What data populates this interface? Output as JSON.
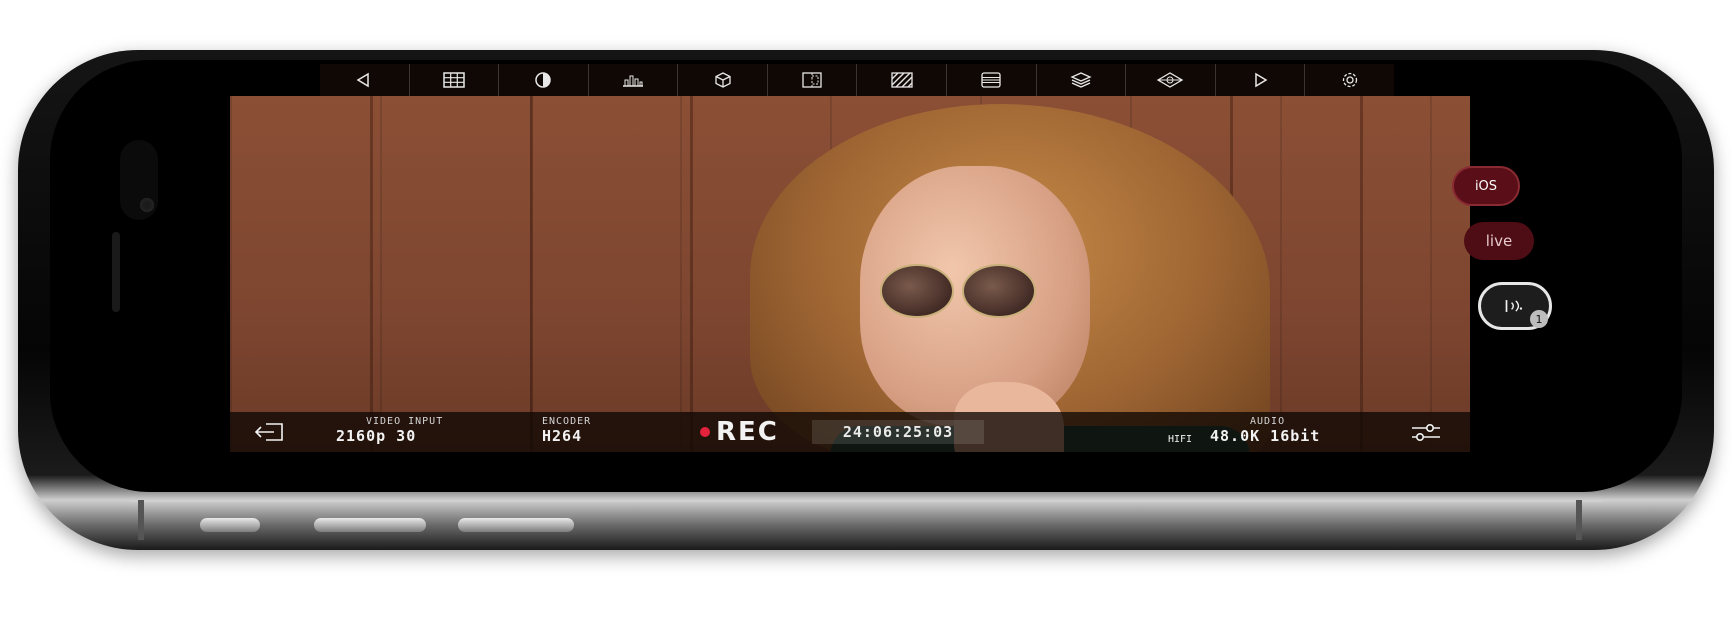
{
  "toolbar": {
    "icons": [
      "prev-arrow-icon",
      "grid-icon",
      "contrast-icon",
      "histogram-icon",
      "cube-icon",
      "frame-guide-icon",
      "zebra-icon",
      "list-lines-icon",
      "layers-icon",
      "focus-peaking-icon",
      "next-arrow-icon",
      "settings-gear-icon"
    ]
  },
  "status": {
    "video_input_label": "VIDEO INPUT",
    "video_input_value": "2160p 30",
    "encoder_label": "ENCODER",
    "encoder_value": "H264",
    "rec_label": "REC",
    "timecode": "24:06:25:03",
    "audio_label": "AUDIO",
    "audio_prefix": "HIFI",
    "audio_value": "48.0K 16bit"
  },
  "right_buttons": {
    "ios_label": "iOS",
    "live_label": "live",
    "audio_badge": "1"
  },
  "colors": {
    "rec_dot": "#e2233b",
    "live_bg": "#4e0d15",
    "ios_bg": "#5a0e17"
  }
}
